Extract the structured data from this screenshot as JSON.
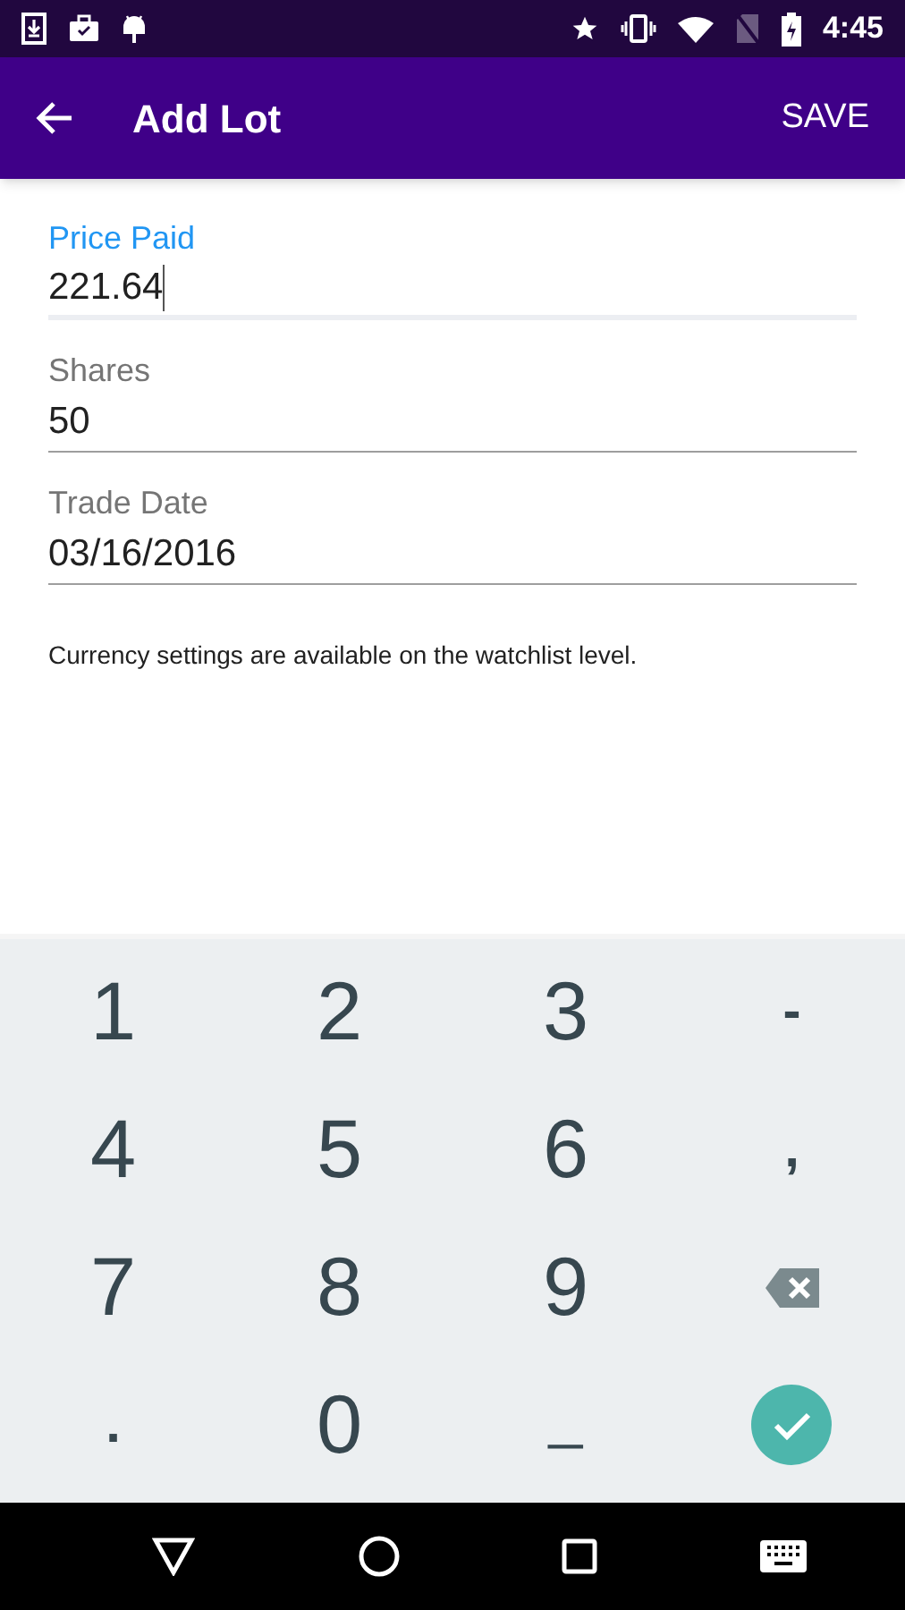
{
  "status_bar": {
    "time": "4:45"
  },
  "app_bar": {
    "title": "Add Lot",
    "action": "SAVE"
  },
  "fields": [
    {
      "label": "Price Paid",
      "value": "221.64",
      "focused": true
    },
    {
      "label": "Shares",
      "value": "50",
      "focused": false
    },
    {
      "label": "Trade Date",
      "value": "03/16/2016",
      "focused": false
    }
  ],
  "note": "Currency settings are available on the watchlist level.",
  "keyboard": {
    "keys": [
      {
        "kind": "text",
        "label": "1"
      },
      {
        "kind": "text",
        "label": "2"
      },
      {
        "kind": "text",
        "label": "3"
      },
      {
        "kind": "symbol",
        "label": "-"
      },
      {
        "kind": "text",
        "label": "4"
      },
      {
        "kind": "text",
        "label": "5"
      },
      {
        "kind": "text",
        "label": "6"
      },
      {
        "kind": "symbol",
        "label": ","
      },
      {
        "kind": "text",
        "label": "7"
      },
      {
        "kind": "text",
        "label": "8"
      },
      {
        "kind": "text",
        "label": "9"
      },
      {
        "kind": "backspace"
      },
      {
        "kind": "symbol",
        "label": "."
      },
      {
        "kind": "text",
        "label": "0"
      },
      {
        "kind": "space",
        "label": "_"
      },
      {
        "kind": "enter"
      }
    ]
  }
}
